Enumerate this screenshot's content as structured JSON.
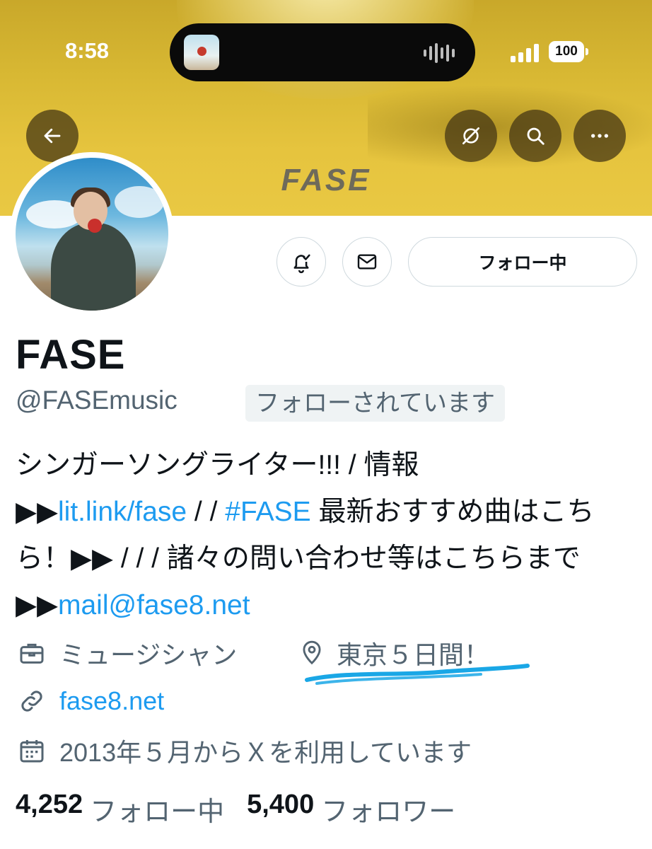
{
  "status_bar": {
    "time": "8:58",
    "battery": "100"
  },
  "banner": {
    "title": "FASE"
  },
  "actions": {
    "follow_label": "フォロー中"
  },
  "profile": {
    "name": "FASE",
    "handle": "@FASEmusic",
    "follows_you": "フォローされています",
    "bio": [
      {
        "text": "シンガーソングライター!!! / 情報",
        "link": false
      },
      {
        "text": "▶▶",
        "link": false
      },
      {
        "text": "lit.link/fase",
        "link": true
      },
      {
        "text": " / / ",
        "link": false
      },
      {
        "text": "#FASE",
        "link": true
      },
      {
        "text": " 最新おすすめ曲はこちら！▶▶ / / / 諸々の問い合わせ等はこちらまで▶▶",
        "link": false
      },
      {
        "text": "mail@fase8.net",
        "link": true
      }
    ],
    "category": "ミュージシャン",
    "location": "東京５日間！",
    "website": "fase8.net",
    "joined": "2013年５月からＸを利用しています",
    "following_count": "4,252",
    "following_label": "フォロー中",
    "followers_count": "5,400",
    "followers_label": "フォロワー"
  },
  "icons": {
    "back": "arrow-left-icon",
    "translate": "translate-icon",
    "search": "search-icon",
    "more": "more-icon",
    "notify": "bell-check-icon",
    "message": "envelope-icon",
    "category": "briefcase-icon",
    "location": "location-pin-icon",
    "website": "link-icon",
    "joined": "calendar-icon"
  },
  "colors": {
    "link": "#1d9bf0",
    "secondary_text": "#536471",
    "banner": "#e3c13f",
    "annotation": "#1aa7e6"
  }
}
